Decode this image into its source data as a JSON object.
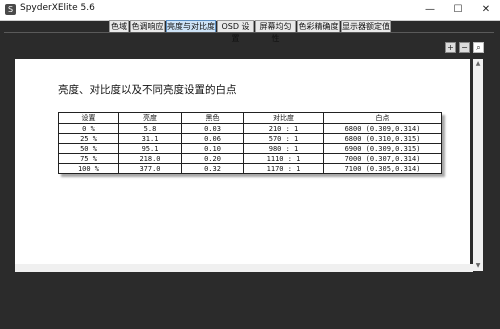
{
  "app": {
    "title": "SpyderXElite 5.6",
    "icon": "S"
  },
  "window_controls": {
    "minimize": "—",
    "maximize": "☐",
    "close": "✕"
  },
  "tabs": [
    "色域",
    "色调响应",
    "亮度与对比度",
    "OSD 设置",
    "屏幕均匀性",
    "色彩精确度",
    "显示器额定值"
  ],
  "active_tab": "亮度与对比度",
  "zoom": {
    "zoom_in": "+",
    "zoom_out": "−",
    "fit": "⌕"
  },
  "report": {
    "title": "亮度、对比度以及不同亮度设置的白点",
    "columns": [
      "设置",
      "亮度",
      "黑色",
      "对比度",
      "白点"
    ],
    "rows": [
      [
        "0 %",
        "5.8",
        "0.03",
        "210 : 1",
        "6800 (0.309,0.314)"
      ],
      [
        "25 %",
        "31.1",
        "0.06",
        "570 : 1",
        "6800 (0.310,0.315)"
      ],
      [
        "50 %",
        "95.1",
        "0.10",
        "980 : 1",
        "6900 (0.309,0.315)"
      ],
      [
        "75 %",
        "218.0",
        "0.20",
        "1110 : 1",
        "7000 (0.307,0.314)"
      ],
      [
        "100 %",
        "377.0",
        "0.32",
        "1170 : 1",
        "7100 (0.305,0.314)"
      ]
    ]
  },
  "scroll": {
    "up": "▲",
    "down": "▼"
  }
}
